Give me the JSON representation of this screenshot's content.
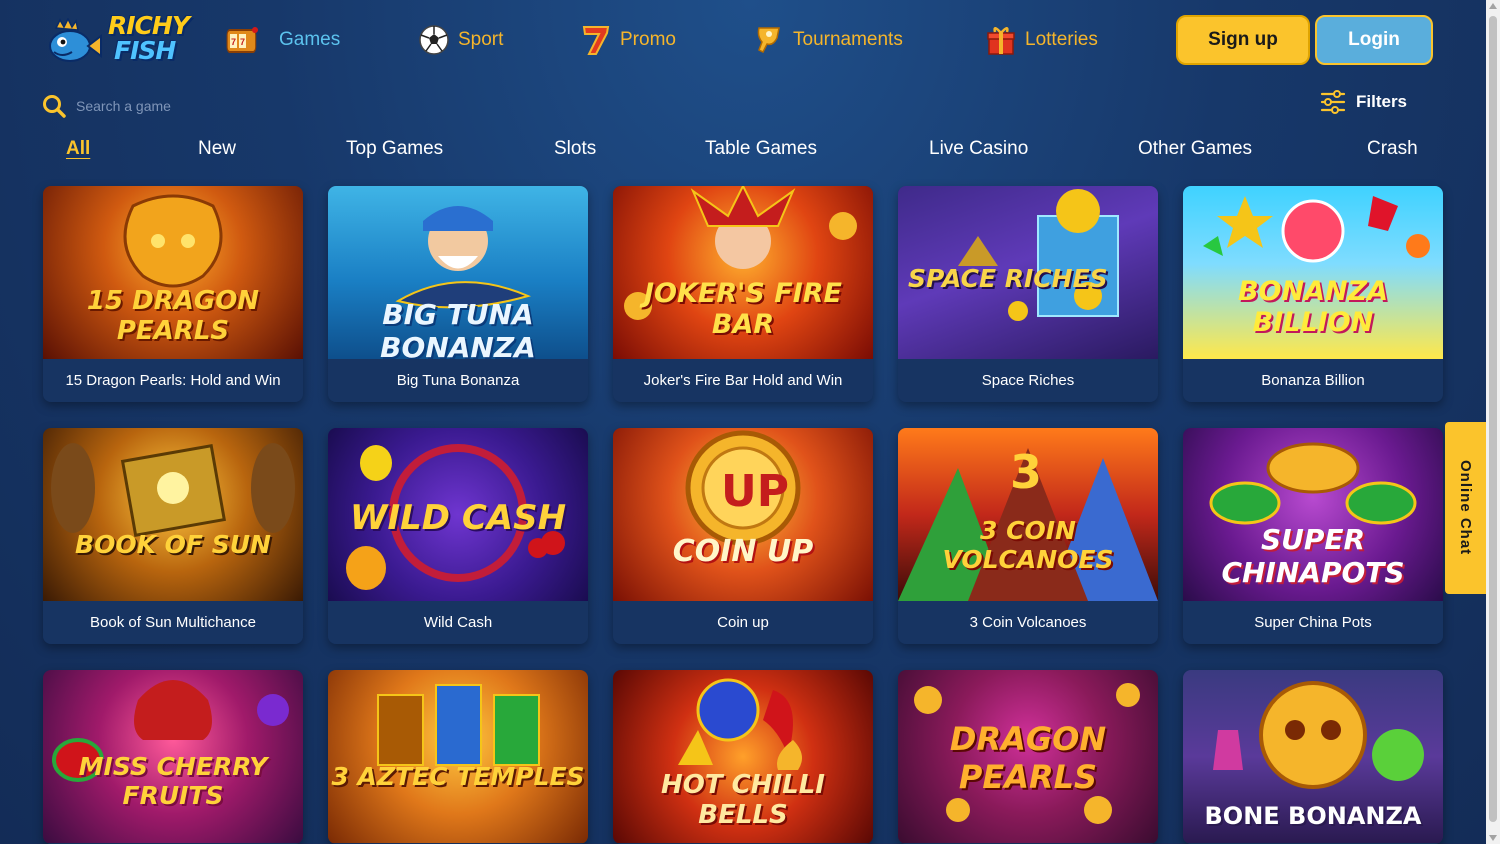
{
  "brand": {
    "logo_line1": "RICHY",
    "logo_line2": "FISH"
  },
  "nav": [
    {
      "label": "Games",
      "icon": "slot-machine-icon"
    },
    {
      "label": "Sport",
      "icon": "soccer-ball-icon"
    },
    {
      "label": "Promo",
      "icon": "seven-icon"
    },
    {
      "label": "Tournaments",
      "icon": "trophy-icon"
    },
    {
      "label": "Lotteries",
      "icon": "gift-icon"
    }
  ],
  "auth": {
    "signup": "Sign up",
    "login": "Login"
  },
  "search": {
    "placeholder": "Search a game"
  },
  "filters": {
    "label": "Filters"
  },
  "tabs": [
    "All",
    "New",
    "Top Games",
    "Slots",
    "Table Games",
    "Live Casino",
    "Other Games",
    "Crash"
  ],
  "games": [
    {
      "title": "15 Dragon Pearls: Hold and Win",
      "art": "15 DRAGON PEARLS"
    },
    {
      "title": "Big Tuna Bonanza",
      "art": "BIG TUNA BONANZA"
    },
    {
      "title": "Joker's Fire Bar Hold and Win",
      "art": "JOKER'S FIRE BAR"
    },
    {
      "title": "Space Riches",
      "art": "SPACE RICHES"
    },
    {
      "title": "Bonanza Billion",
      "art": "BONANZA BILLION"
    },
    {
      "title": "Book of Sun Multichance",
      "art": "BOOK OF SUN"
    },
    {
      "title": "Wild Cash",
      "art": "WILD CASH"
    },
    {
      "title": "Coin up",
      "art": "COIN UP"
    },
    {
      "title": "3 Coin Volcanoes",
      "art": "3 COIN VOLCANOES"
    },
    {
      "title": "Super China Pots",
      "art": "SUPER CHINAPOTS"
    },
    {
      "art": "MISS CHERRY FRUITS"
    },
    {
      "art": "3 AZTEC TEMPLES"
    },
    {
      "art": "HOT CHILLI BELLS"
    },
    {
      "art": "DRAGON PEARLS"
    },
    {
      "art": "BONE BONANZA"
    }
  ],
  "online_chat": "Online Chat",
  "colors": {
    "accent": "#fbc42c",
    "login": "#5aaedc",
    "active_nav": "#5cc3ee",
    "nav": "#f5b52b"
  }
}
